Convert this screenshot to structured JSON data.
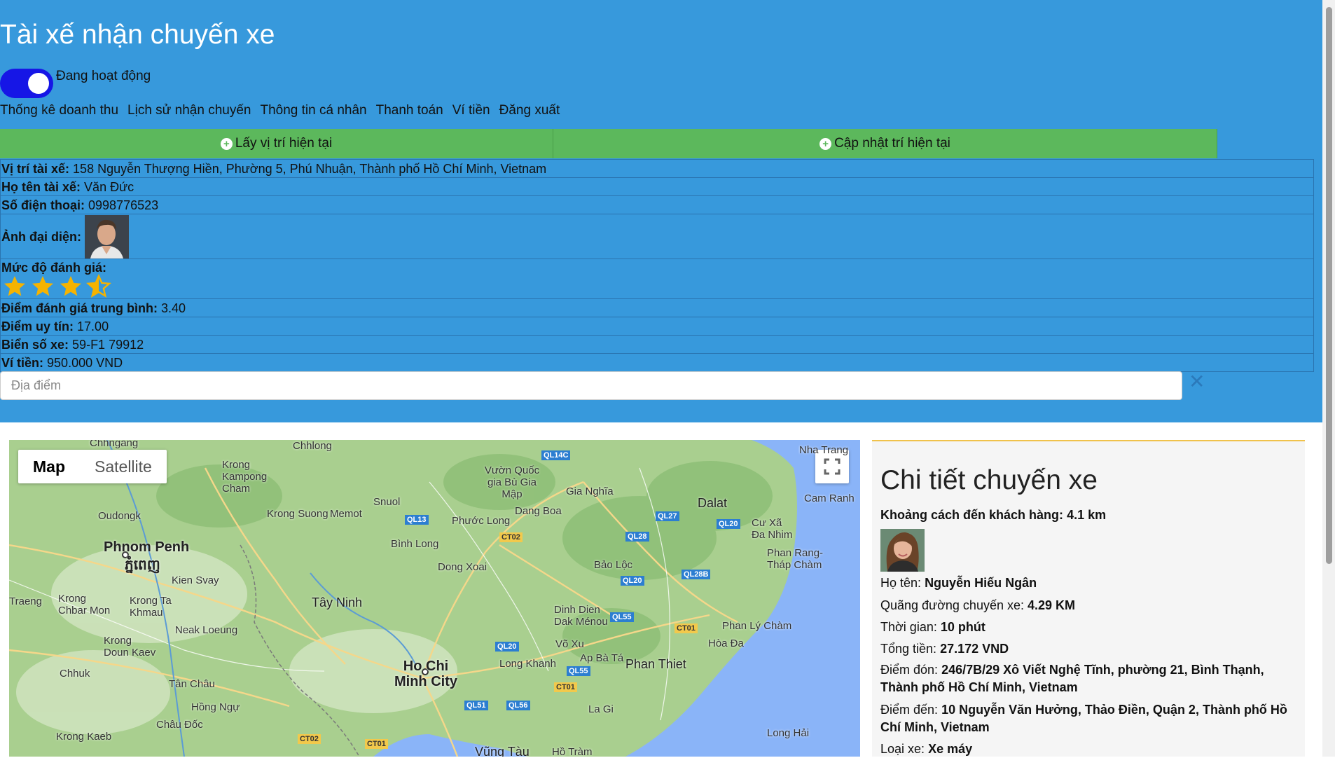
{
  "page": {
    "title": "Tài xế nhận chuyến xe",
    "status_label": "Đang hoạt động",
    "status_on": true
  },
  "nav": [
    "Thống kê doanh thu",
    "Lịch sử nhận chuyến",
    "Thông tin cá nhân",
    "Thanh toán",
    "Ví tiền",
    "Đăng xuất"
  ],
  "buttons": {
    "get_location": "Lấy vị trí hiện tại",
    "update_location": "Cập nhật trí hiện tại"
  },
  "driver": {
    "location_label": "Vị trí tài xế:",
    "location": "158 Nguyễn Thượng Hiền, Phường 5, Phú Nhuận, Thành phố Hồ Chí Minh, Vietnam",
    "name_label": "Họ tên tài xế:",
    "name": "Văn Đức",
    "phone_label": "Số điện thoại:",
    "phone": "0998776523",
    "avatar_label": "Ảnh đại diện:",
    "rating_label": "Mức độ đánh giá:",
    "rating_stars": 3.4,
    "avg_label": "Điểm đánh giá trung bình:",
    "avg": "3.40",
    "trust_label": "Điểm uy tín:",
    "trust": "17.00",
    "plate_label": "Biển số xe:",
    "plate": "59-F1 79912",
    "wallet_label": "Ví tiền:",
    "wallet": "950.000 VND"
  },
  "search": {
    "placeholder": "Địa điểm",
    "value": ""
  },
  "map": {
    "type_map": "Map",
    "type_satellite": "Satellite",
    "places": {
      "chhngang": "Chhngang",
      "chhlong": "Chhlong",
      "kampong_cham": "Krong Kampong Cham",
      "oudongk": "Oudongk",
      "phnom_penh": "Phnom Penh",
      "phnom_penh_km": "ភ្នំពេញ",
      "kien_svay": "Kien Svay",
      "krong_suong": "Krong Suong",
      "memot": "Memot",
      "snuol": "Snuol",
      "tay_ninh": "Tây Ninh",
      "binh_long": "Bình Long",
      "phuoc_long": "Phước Long",
      "dong_xoai": "Dong Xoai",
      "dang_boa": "Dang Boa",
      "vuon_quoc_gia": "Vườn Quốc gia Bù Gia Mập",
      "gia_nghia": "Gia Nghĩa",
      "dalat": "Dalat",
      "cu_xa": "Cư Xã Đa Nhim",
      "cam_ranh": "Cam Ranh",
      "phan_rang": "Phan Rang-Tháp Chàm",
      "bao_loc": "Bảo Lộc",
      "dinh_dien": "Dinh Dien Dak Ménou",
      "vo_xu": "Võ Xu",
      "ap_ba_ta": "Ap Bà Tá",
      "phan_thiet": "Phan Thiet",
      "hoa_da": "Hòa Đa",
      "phan_ly_cham": "Phan Lý Chàm",
      "ho_chi_minh": "Ho Chi Minh City",
      "long_khanh": "Long Khanh",
      "la_gi": "La Gi",
      "long_hai": "Long Hải",
      "vung_tau": "Vũng Tàu",
      "ho_tram": "Hồ Tràm",
      "traeng": "Traeng",
      "chbar_mon": "Krong Chbar Mon",
      "krong_ta_khmau": "Krong Ta Khmau",
      "neak_loeung": "Neak Loeung",
      "doun_kaev": "Krong Doun Kaev",
      "chhuk": "Chhuk",
      "tan_chau": "Tân Châu",
      "hong_ngu": "Hồng Ngự",
      "chau_doc": "Châu Đốc",
      "kampot": "Krong Kaeb",
      "nha_trang": "Nha Trang"
    },
    "roads": [
      "QL14C",
      "QL13",
      "CT02",
      "QL27",
      "QL28",
      "QL20",
      "QL20",
      "QL28B",
      "QL55",
      "CT01",
      "QL20",
      "QL55",
      "CT01",
      "QL51",
      "QL56",
      "CT02",
      "CT01"
    ]
  },
  "trip": {
    "title": "Chi tiết chuyến xe",
    "distance_label": "Khoảng cách đến khách hàng:",
    "distance": "4.1 km",
    "name_label": "Họ tên:",
    "name": "Nguyễn Hiếu Ngân",
    "route_label": "Quãng đường chuyến xe:",
    "route": "4.29 KM",
    "time_label": "Thời gian:",
    "time": "10 phút",
    "total_label": "Tổng tiền:",
    "total": "27.172 VND",
    "pickup_label": "Điểm đón:",
    "pickup": "246/7B/29 Xô Viết Nghệ Tĩnh, phường 21, Bình Thạnh, Thành phố Hồ Chí Minh, Vietnam",
    "dropoff_label": "Điểm đến:",
    "dropoff": "10 Nguyễn Văn Hưởng, Thảo Điền, Quận 2, Thành phố Hồ Chí Minh, Vietnam",
    "vehicle_label": "Loại xe:",
    "vehicle": "Xe máy"
  },
  "colors": {
    "header_bg": "#3799dc",
    "toggle": "#1616e6",
    "button_green": "#5cb85c",
    "star": "#f5b301"
  }
}
